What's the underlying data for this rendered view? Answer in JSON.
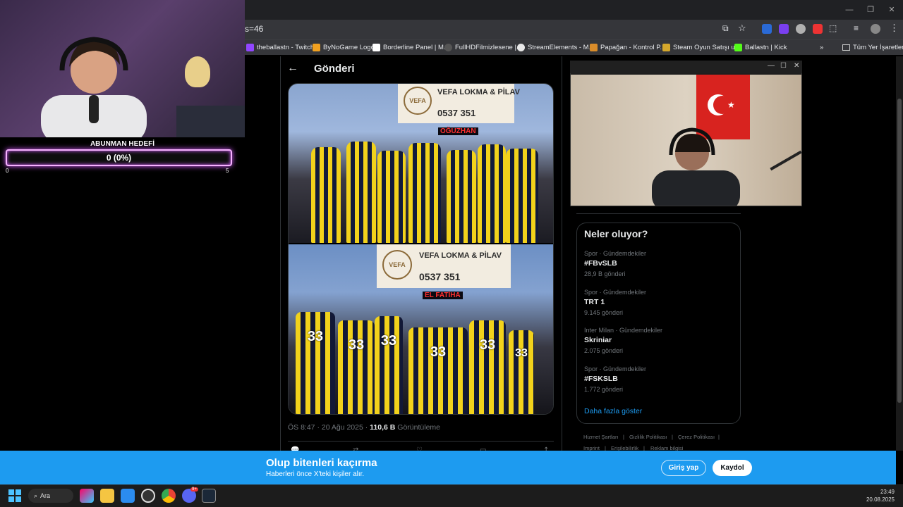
{
  "browser": {
    "url_fragment": "s=46",
    "bookmarks": [
      {
        "label": "theballastn - Twitch",
        "color": "#9146ff"
      },
      {
        "label": "ByNoGame Logo",
        "color": "#f0a020"
      },
      {
        "label": "Borderline Panel | M...",
        "color": "#ffffff"
      },
      {
        "label": "FullHDFilmizlesene |...",
        "color": "#333333"
      },
      {
        "label": "StreamElements - M...",
        "color": "#e8e8e8"
      },
      {
        "label": "Papağan - Kontrol P...",
        "color": "#d98c2a"
      },
      {
        "label": "Steam Oyun Satışı u...",
        "color": "#d4a72c"
      },
      {
        "label": "Ballastn | Kick",
        "color": "#53fc18"
      }
    ],
    "bookmarks_more": "»",
    "all_bookmarks": "Tüm Yer İşaretleri"
  },
  "stream_overlay": {
    "goal_title": "ABUNMAN HEDEFİ",
    "goal_value": "0 (0%)",
    "goal_progress": 0,
    "goal_min": "0",
    "goal_max": "5"
  },
  "post": {
    "back_icon": "arrow-left-icon",
    "title": "Gönderi",
    "banner_text_1": "VEFA LOKMA & PİLAV",
    "phone_1": "0537 351",
    "led_1": "OĞUZHAN",
    "banner_text_2": "VEFA LOKMA & PİLAV",
    "phone_2": "0537 351",
    "led_2": "EL FATİHA",
    "jersey_number": "33",
    "time": "ÖS 8:47 · 20 Ağu 2025 ·",
    "views": "110,6 B",
    "views_label": "Görüntüleme"
  },
  "trends": {
    "title": "Neler oluyor?",
    "items": [
      {
        "category": "Spor · Gündemdekiler",
        "name": "#FBvSLB",
        "count": "28,9 B gönderi"
      },
      {
        "category": "Spor · Gündemdekiler",
        "name": "TRT 1",
        "count": "9.145 gönderi"
      },
      {
        "category": "Inter Milan · Gündemdekiler",
        "name": "Skriniar",
        "count": "2.075 gönderi"
      },
      {
        "category": "Spor · Gündemdekiler",
        "name": "#FSKSLB",
        "count": "1.772 gönderi"
      }
    ],
    "show_more": "Daha fazla göster"
  },
  "footer_links": [
    "Hizmet Şartları",
    "Gizlilik Politikası",
    "Çerez Politikası",
    "Imprint",
    "Erişilebilirlik",
    "Reklam bilgisi"
  ],
  "login_banner": {
    "title": "Olup bitenleri kaçırma",
    "subtitle": "Haberleri önce X'teki kişiler alır.",
    "login": "Giriş yap",
    "signup": "Kaydol"
  },
  "taskbar": {
    "search": "Ara",
    "time": "23:49",
    "date": "20.08.2025",
    "discord_badge": "9+"
  },
  "colors": {
    "accent": "#1d9bf0",
    "goal_glow": "#d55cff"
  }
}
